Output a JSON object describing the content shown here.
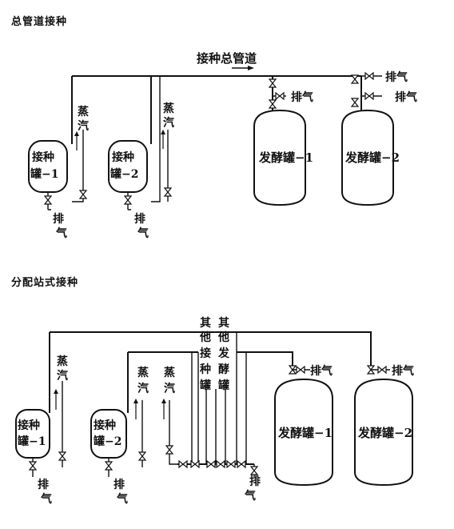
{
  "section1": {
    "title": "总管道接种",
    "main_pipe_label": "接种总管道",
    "seed_tank_1": [
      "接种",
      "罐−1"
    ],
    "seed_tank_2": [
      "接种",
      "罐−2"
    ],
    "steam_1": [
      "蒸",
      "汽"
    ],
    "steam_2": [
      "蒸",
      "汽"
    ],
    "vent_seed_1": [
      "排",
      "气"
    ],
    "vent_seed_2": [
      "排",
      "气"
    ],
    "ferm_1": "发酵罐−1",
    "ferm_2": "发酵罐−2",
    "vent_top_1": "排气",
    "vent_top_2": "排气",
    "vent_top_3": "排气"
  },
  "section2": {
    "title": "分配站式接种",
    "seed_tank_1": [
      "接种",
      "罐−1"
    ],
    "seed_tank_2": [
      "接种",
      "罐−2"
    ],
    "steam_1": [
      "蒸",
      "汽"
    ],
    "steam_2": [
      "蒸",
      "汽"
    ],
    "steam_3": [
      "蒸",
      "汽"
    ],
    "other_seed": [
      "其",
      "他",
      "接",
      "种",
      "罐"
    ],
    "other_ferm": [
      "其",
      "他",
      "发",
      "酵",
      "罐"
    ],
    "vent_seed_1": [
      "排",
      "气"
    ],
    "vent_seed_2": [
      "排",
      "气"
    ],
    "vent_station": [
      "排",
      "气"
    ],
    "ferm_1": "发酵罐−1",
    "ferm_2": "发酵罐−2",
    "vent_top_1": "排气",
    "vent_top_2": "排气"
  }
}
